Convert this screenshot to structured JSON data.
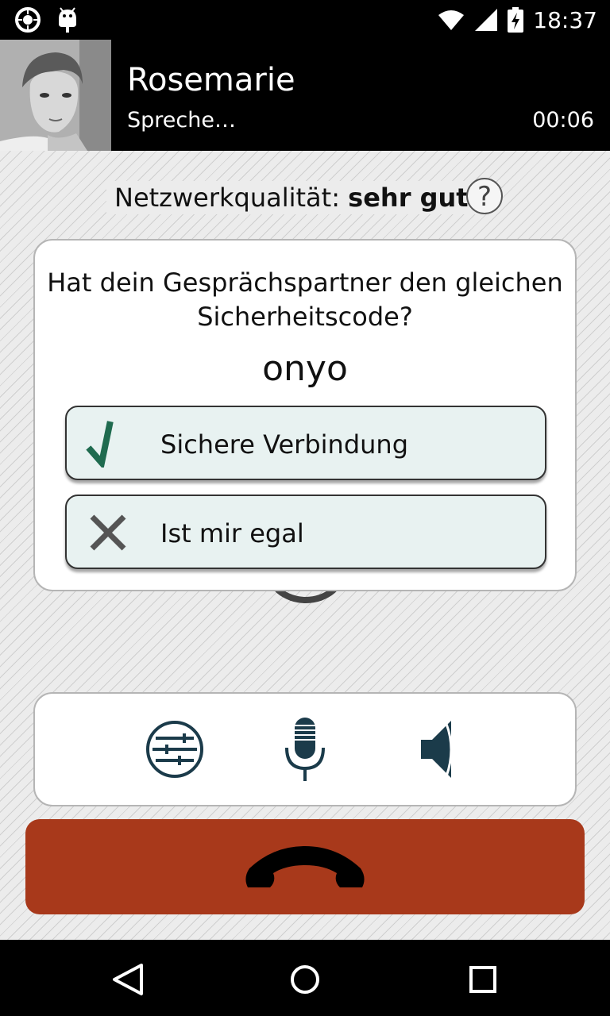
{
  "status_bar": {
    "time": "18:37",
    "icons": [
      "cyanogen-icon",
      "android-debug-icon",
      "wifi-icon",
      "cell-signal-icon",
      "battery-charging-icon"
    ]
  },
  "header": {
    "contact_name": "Rosemarie",
    "call_status": "Spreche…",
    "call_duration": "00:06"
  },
  "network_quality": {
    "label": "Netzwerkqualität:",
    "value": "sehr gut",
    "help_symbol": "?"
  },
  "verify_dialog": {
    "question": "Hat dein Gesprächspartner den gleichen Sicherheitscode?",
    "code": "onyo",
    "options": [
      {
        "label": "Sichere Verbindung",
        "icon": "checkmark-icon",
        "color": "#1f6b4f"
      },
      {
        "label": "Ist mir egal",
        "icon": "x-icon",
        "color": "#555555"
      }
    ]
  },
  "call_controls": {
    "icons": [
      "equalizer-icon",
      "microphone-icon",
      "speaker-icon"
    ],
    "icon_color": "#1b3b4a"
  },
  "hangup": {
    "icon": "phone-hangup-icon",
    "color": "#a8391b"
  },
  "nav_bar": {
    "icons": [
      "back-icon",
      "home-icon",
      "recents-icon"
    ]
  }
}
